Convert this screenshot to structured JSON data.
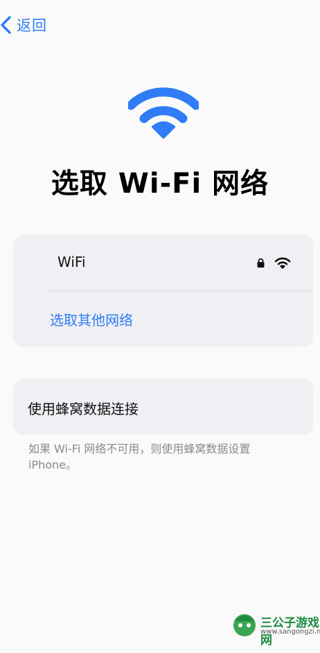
{
  "nav": {
    "back_label": "返回"
  },
  "page": {
    "title": "选取 Wi-Fi 网络"
  },
  "networks": [
    {
      "name": "WiFi",
      "secured": true,
      "icon": "wifi-icon"
    }
  ],
  "other_network_label": "选取其他网络",
  "cellular": {
    "label": "使用蜂窝数据连接",
    "footnote": "如果 Wi-Fi 网络不可用，则使用蜂窝数据设置 iPhone。"
  },
  "watermark": {
    "title": "三公子游戏网",
    "url": "www.sangongzi.net"
  },
  "colors": {
    "accent": "#2f7cf6",
    "background": "#fafafa",
    "card": "#efeff4",
    "secondary_text": "#8a8a8e"
  }
}
